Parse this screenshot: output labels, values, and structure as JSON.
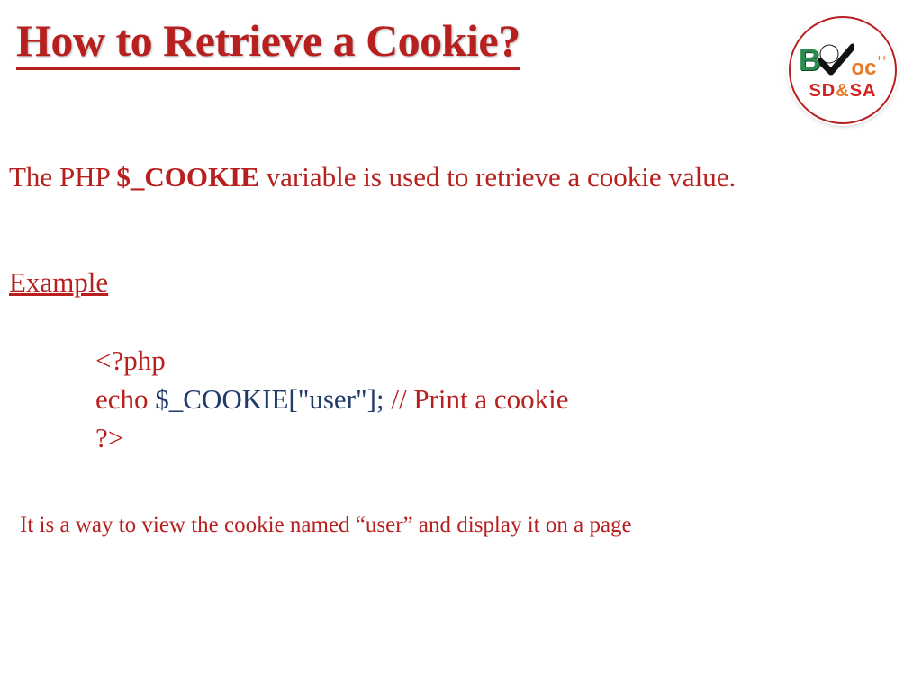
{
  "title": "How to Retrieve  a Cookie?",
  "logo": {
    "b": "B",
    "oc": "oc",
    "plus": "++",
    "sd": "SD",
    "amp": "&",
    "sa": "SA"
  },
  "intro": {
    "prefix": "The PHP ",
    "var": "$_COOKIE",
    "suffix": " variable is used to retrieve a cookie value."
  },
  "example_label": "Example",
  "code": {
    "line1": "<?php",
    "line2a": "echo ",
    "line2b": "$_COOKIE[\"user\"];",
    "line2c": " // Print a cookie",
    "line3": "?>"
  },
  "footer": "It is a way to view the cookie named “user” and display it on a page"
}
